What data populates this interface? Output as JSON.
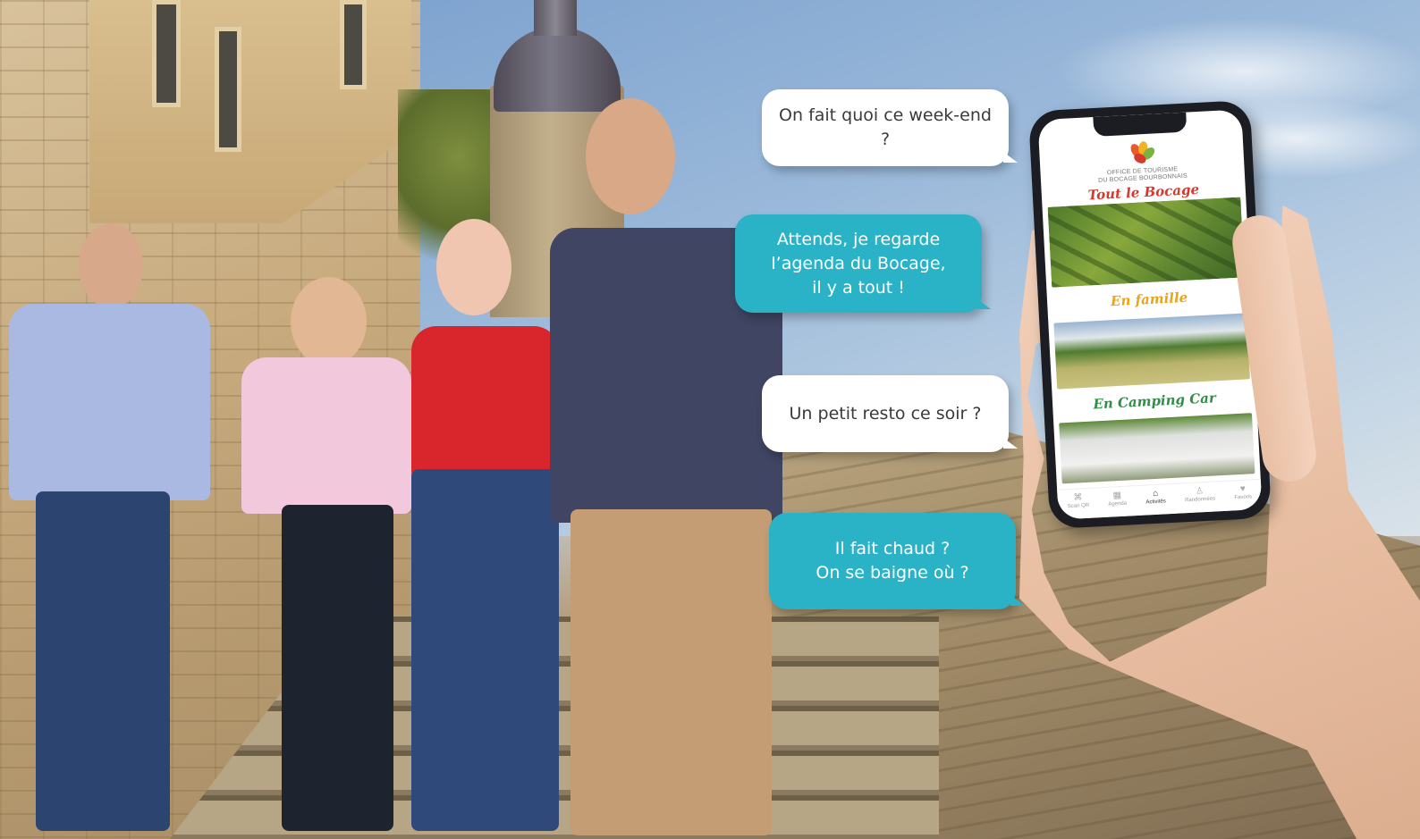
{
  "bubbles": [
    {
      "id": "b1",
      "style": "white",
      "lines": [
        "On fait quoi ce week-end ?"
      ]
    },
    {
      "id": "b2",
      "style": "teal",
      "lines": [
        "Attends, je regarde",
        "l’agenda du Bocage,",
        "il y a tout !"
      ]
    },
    {
      "id": "b3",
      "style": "white",
      "lines": [
        "Un petit resto ce soir ?"
      ]
    },
    {
      "id": "b4",
      "style": "teal",
      "lines": [
        "Il fait chaud ?",
        "On se baigne où ?"
      ]
    }
  ],
  "app": {
    "brand_line1": "OFFICE DE TOURISME",
    "brand_line2": "DU BOCAGE BOURBONNAIS",
    "sections": [
      {
        "label": "Tout le Bocage",
        "color": "#d63a2c"
      },
      {
        "label": "En famille",
        "color": "#e9a418"
      },
      {
        "label": "En Camping Car",
        "color": "#2e8f46"
      }
    ],
    "tabs": [
      {
        "label": "Scan QR",
        "icon": "scan-icon",
        "glyph": "⌘",
        "active": false
      },
      {
        "label": "Agenda",
        "icon": "calendar-icon",
        "glyph": "▦",
        "active": false
      },
      {
        "label": "Activités",
        "icon": "home-icon",
        "glyph": "⌂",
        "active": true
      },
      {
        "label": "Randonnées",
        "icon": "hiker-icon",
        "glyph": "♙",
        "active": false
      },
      {
        "label": "Favoris",
        "icon": "heart-icon",
        "glyph": "♥",
        "active": false
      }
    ]
  },
  "colors": {
    "bubble_teal": "#2ab3c6",
    "bubble_white": "#ffffff"
  }
}
